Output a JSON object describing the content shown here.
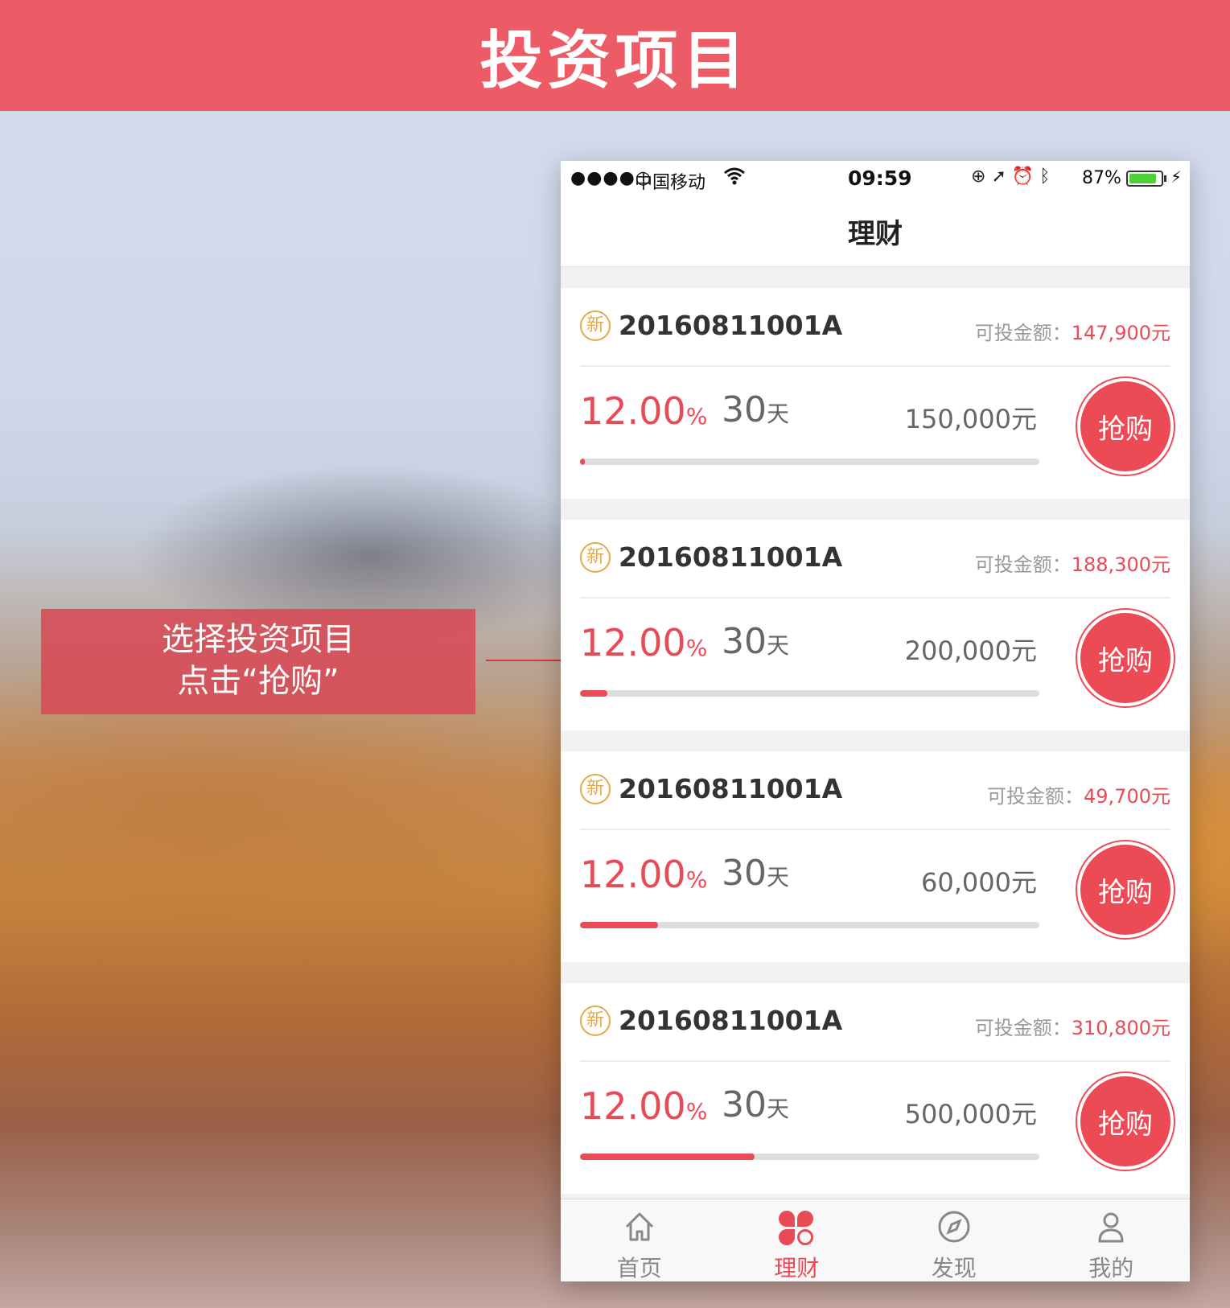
{
  "banner": {
    "title": "投资项目"
  },
  "callout": {
    "line1": "选择投资项目",
    "line2": "点击“抢购”"
  },
  "status_bar": {
    "signal": "●●●●○",
    "carrier": "中国移动",
    "time": "09:59",
    "battery": "87%",
    "battery_level": 0.87
  },
  "nav": {
    "title": "理财"
  },
  "products": [
    {
      "badge": "新",
      "code": "20160811001A",
      "avail_label": "可投金额：",
      "avail_amount": "147,900元",
      "rate": "12.00",
      "rate_unit": "%",
      "term": "30",
      "term_unit": "天",
      "total": "150,000元",
      "progress": 0.01,
      "buy_label": "抢购"
    },
    {
      "badge": "新",
      "code": "20160811001A",
      "avail_label": "可投金额：",
      "avail_amount": "188,300元",
      "rate": "12.00",
      "rate_unit": "%",
      "term": "30",
      "term_unit": "天",
      "total": "200,000元",
      "progress": 0.06,
      "buy_label": "抢购"
    },
    {
      "badge": "新",
      "code": "20160811001A",
      "avail_label": "可投金额：",
      "avail_amount": "49,700元",
      "rate": "12.00",
      "rate_unit": "%",
      "term": "30",
      "term_unit": "天",
      "total": "60,000元",
      "progress": 0.17,
      "buy_label": "抢购"
    },
    {
      "badge": "新",
      "code": "20160811001A",
      "avail_label": "可投金额：",
      "avail_amount": "310,800元",
      "rate": "12.00",
      "rate_unit": "%",
      "term": "30",
      "term_unit": "天",
      "total": "500,000元",
      "progress": 0.38,
      "buy_label": "抢购"
    }
  ],
  "tabbar": [
    {
      "label": "首页",
      "icon": "home-icon",
      "active": false
    },
    {
      "label": "理财",
      "icon": "clover-icon",
      "active": true
    },
    {
      "label": "发现",
      "icon": "compass-icon",
      "active": false
    },
    {
      "label": "我的",
      "icon": "person-icon",
      "active": false
    }
  ],
  "colors": {
    "accent": "#ec4a55",
    "banner": "#ec5b66",
    "badge": "#e7a94a"
  }
}
